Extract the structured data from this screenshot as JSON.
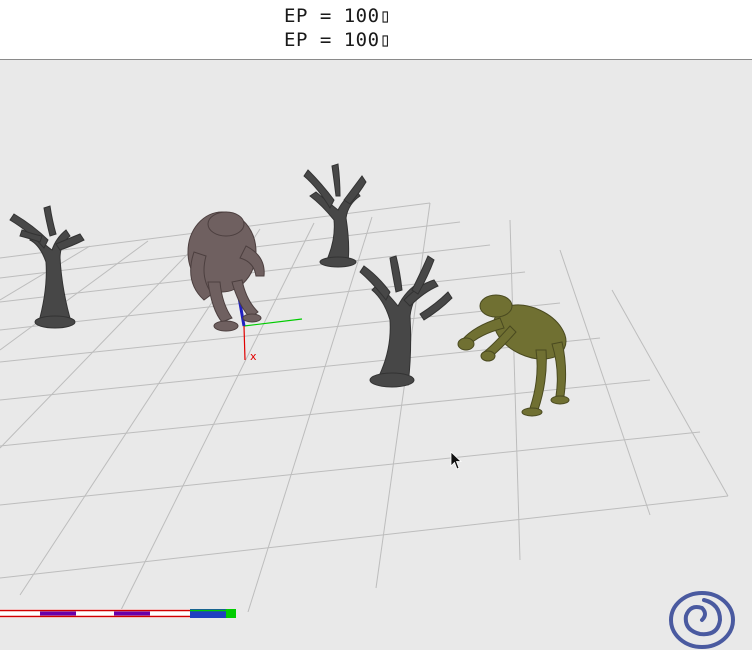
{
  "hud": {
    "ep_lines": [
      "EP = 100▯",
      "EP = 100▯"
    ]
  },
  "scene": {
    "background": "#e9e9e9",
    "grid_color": "#bdbdbd",
    "axes": {
      "x_label": "x",
      "x_color": "#e00000",
      "y_color": "#00cc00",
      "z_color": "#2020c0"
    },
    "entities": [
      {
        "name": "dead-tree",
        "color": "#474747"
      },
      {
        "name": "ape-creature",
        "color": "#6f6060"
      },
      {
        "name": "goblin-creature",
        "color": "#707032"
      }
    ],
    "logo_icon": "spiral-logo-icon",
    "cursor_icon": "arrow-cursor-icon"
  },
  "status_bar": {
    "colors": [
      "#d00000",
      "#ffffff",
      "#2040c0",
      "#6a00aa",
      "#00cc00"
    ]
  }
}
